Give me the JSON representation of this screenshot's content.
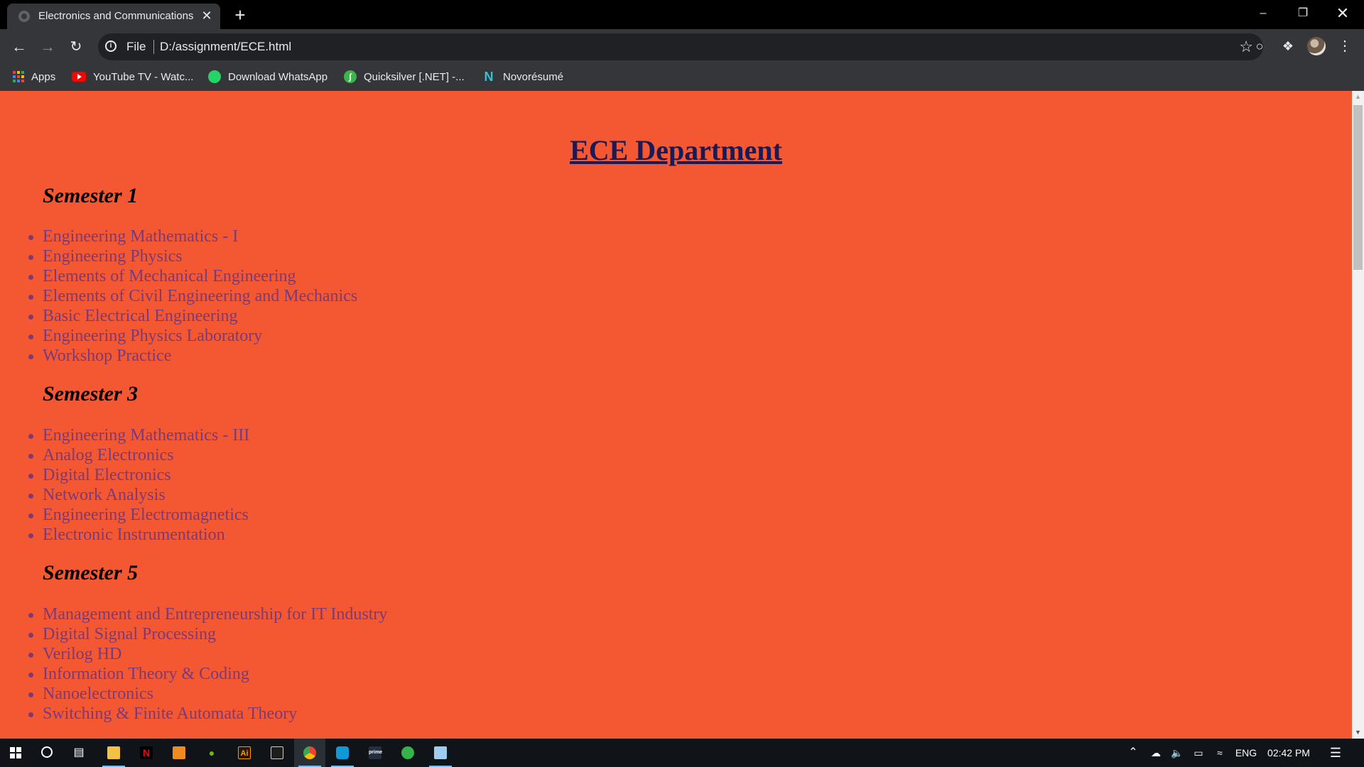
{
  "browser": {
    "tab_title": "Electronics and Communications",
    "url_scheme": "File",
    "url": "D:/assignment/ECE.html"
  },
  "bookmarks": [
    {
      "label": "Apps",
      "icon": "apps-grid-icon"
    },
    {
      "label": "YouTube TV - Watc...",
      "icon": "youtube-icon"
    },
    {
      "label": "Download WhatsApp",
      "icon": "whatsapp-icon"
    },
    {
      "label": "Quicksilver [.NET] -...",
      "icon": "quicksilver-icon"
    },
    {
      "label": "Novorésumé",
      "icon": "novoresume-icon"
    }
  ],
  "page": {
    "title": "ECE Department",
    "background": "#f45833",
    "semesters": [
      {
        "heading": "Semester 1",
        "courses": [
          "Engineering Mathematics - I",
          "Engineering Physics",
          "Elements of Mechanical Engineering",
          "Elements of Civil Engineering and Mechanics",
          "Basic Electrical Engineering",
          "Engineering Physics Laboratory",
          "Workshop Practice"
        ]
      },
      {
        "heading": "Semester 3",
        "courses": [
          "Engineering Mathematics - III",
          "Analog Electronics",
          "Digital Electronics",
          "Network Analysis",
          "Engineering Electromagnetics",
          "Electronic Instrumentation"
        ]
      },
      {
        "heading": "Semester 5",
        "courses": [
          "Management and Entrepreneurship for IT Industry",
          "Digital Signal Processing",
          "Verilog HD",
          "Information Theory & Coding",
          "Nanoelectronics",
          "Switching & Finite Automata Theory"
        ]
      }
    ]
  },
  "taskbar": {
    "language": "ENG",
    "time": "02:42 PM"
  }
}
